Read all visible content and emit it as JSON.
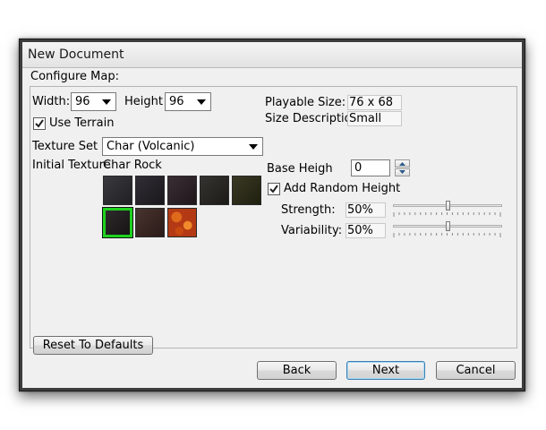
{
  "window": {
    "title": "New Document"
  },
  "configure": {
    "group_label": "Configure Map:",
    "width_label": "Width:",
    "width_value": "96",
    "height_label": "Height",
    "height_value": "96",
    "use_terrain_label": "Use Terrain",
    "use_terrain_checked": true,
    "texture_set_label": "Texture Set",
    "texture_set_value": "Char (Volcanic)",
    "initial_texture_label": "Initial Texture",
    "initial_texture_value": "Char Rock",
    "playable_size_label": "Playable Size:",
    "playable_size_value": "76 x 68",
    "size_description_label": "Size Descriptio",
    "size_description_value": "Small",
    "base_height_label": "Base Heigh",
    "base_height_value": "0",
    "add_random_height_label": "Add Random Height",
    "add_random_height_checked": true,
    "strength_label": "Strength:",
    "strength_value": "50%",
    "strength_level": 0.5,
    "variability_label": "Variability:",
    "variability_value": "50%",
    "variability_level": 0.5,
    "textures": [
      {
        "name": "texture-tile-1",
        "color": "#2a2a30",
        "selected": false
      },
      {
        "name": "texture-tile-2",
        "color": "#221e26",
        "selected": false
      },
      {
        "name": "texture-tile-3",
        "color": "#2a1e24",
        "selected": false
      },
      {
        "name": "texture-tile-4",
        "color": "#262420",
        "selected": false
      },
      {
        "name": "texture-tile-5",
        "color": "#2a2a14",
        "selected": false
      },
      {
        "name": "texture-tile-6",
        "color": "#1e1a1c",
        "selected": true
      },
      {
        "name": "texture-tile-7",
        "color": "#3a2420",
        "selected": false
      },
      {
        "name": "texture-tile-8",
        "color": "#b33a14",
        "selected": false
      }
    ]
  },
  "buttons": {
    "reset": "Reset To Defaults",
    "back": "Back",
    "next": "Next",
    "cancel": "Cancel"
  },
  "colors": {
    "selected_border": "#1ed21e",
    "window_frame": "#3c3c3c",
    "client_bg": "#f0f0f0"
  }
}
